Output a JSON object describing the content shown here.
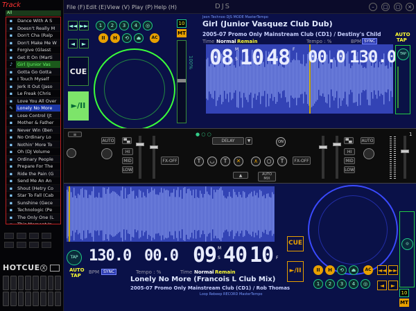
{
  "left_panel": {
    "title": "Track",
    "all_label": "All",
    "playlist": [
      {
        "title": "Dance With A S",
        "state": "normal"
      },
      {
        "title": "Doesn't Really M",
        "state": "normal"
      },
      {
        "title": "Don't Cha (Ralp",
        "state": "normal"
      },
      {
        "title": "Don't Make Me W",
        "state": "normal"
      },
      {
        "title": "Forgive (Glasst",
        "state": "normal"
      },
      {
        "title": "Get It On (Marti",
        "state": "normal"
      },
      {
        "title": "Girl (Junior Vas",
        "state": "playing_a"
      },
      {
        "title": "Gotta Go Gotta",
        "state": "normal"
      },
      {
        "title": "I Touch Myself",
        "state": "normal"
      },
      {
        "title": "Jerk It Out (Jaso",
        "state": "normal"
      },
      {
        "title": "Le Freak (Chris",
        "state": "normal"
      },
      {
        "title": "Love You All Over",
        "state": "normal"
      },
      {
        "title": "Lonely No More",
        "state": "playing_b"
      },
      {
        "title": "Lose Control (Jt",
        "state": "normal"
      },
      {
        "title": "Mother & Father",
        "state": "normal"
      },
      {
        "title": "Never Win (Ben",
        "state": "normal"
      },
      {
        "title": "No Ordinary Lo",
        "state": "normal"
      },
      {
        "title": "Nothin' More To",
        "state": "normal"
      },
      {
        "title": "Oh (DJ Volume",
        "state": "normal"
      },
      {
        "title": "Ordinary People",
        "state": "normal"
      },
      {
        "title": "Prepare For The",
        "state": "normal"
      },
      {
        "title": "Ride the Pain (G",
        "state": "normal"
      },
      {
        "title": "Send Me An An",
        "state": "normal"
      },
      {
        "title": "Shout (Hetry Co",
        "state": "normal"
      },
      {
        "title": "Star To Fall (Cab",
        "state": "normal"
      },
      {
        "title": "Sunshine (Gece",
        "state": "normal"
      },
      {
        "title": "Technologic (Pe",
        "state": "normal"
      },
      {
        "title": "The Only One (L",
        "state": "normal"
      },
      {
        "title": "This Moment In",
        "state": "normal"
      },
      {
        "title": "We Belong Toget",
        "state": "normal"
      },
      {
        "title": "When The Broke",
        "state": "normal"
      }
    ],
    "hotcue_label": "HOTCUE",
    "hotcue_x": "X"
  },
  "menu": {
    "items": [
      "File (F)",
      "Edit (E)",
      "View (V)",
      "Play (P)",
      "Help (H)"
    ],
    "app_title": "DJS"
  },
  "deck_a": {
    "brand": "Jeon  Technoo  DJS MODE  MasterTempo",
    "title": "Girl (Junior Vasquez Club Dub)",
    "subtitle": "2005-07 Promo Only Mainstream Club (CD1) / Destiny's Child",
    "time_label": "Time",
    "normal": "Normal",
    "remain": "Remain",
    "tempo_label": "Tempo : %",
    "bpm_label": "BPM",
    "sync_label": "SYNC",
    "time_m": "08",
    "time_s": "10",
    "time_f": "48",
    "unit_m": "M",
    "unit_s": "S",
    "unit_f": "F",
    "tempo": "00.0",
    "bpm": "130.0",
    "cue": "CUE",
    "play": "►/II",
    "pitch_num": "10",
    "mt": "MT",
    "auto": "AUTO",
    "tap": "TAP",
    "pitch_text": "100%",
    "counter_text": "1 2 3 4"
  },
  "mixer": {
    "effect": "DELAY",
    "on": "ON",
    "fx_off_left": "FX-OFF",
    "fx_off_right": "FX-OFF",
    "auto_mix": "AUTO MIX",
    "auto": "AUTO",
    "hi": "HI",
    "mid": "MID",
    "low": "LOW",
    "gain": "GAIN",
    "vol_master": "1"
  },
  "deck_b": {
    "title": "Lonely No More (Francois L Club Mix)",
    "subtitle": "2005-07 Promo Only Mainstream Club (CD1) / Rob Thomas",
    "brand": "Loop  Rebeep  RECORD  MasterTempo",
    "time_label": "Time",
    "normal": "Normal",
    "remain": "Remain",
    "tempo_label": "Tempo : %",
    "bpm_label": "BPM",
    "sync_label": "SYNC",
    "time_m": "09",
    "time_s": "40",
    "time_f": "10",
    "unit_m": "M",
    "unit_s": "S",
    "unit_f": "F",
    "tempo": "00.0",
    "bpm": "130.0",
    "cue": "CUE",
    "play": "►/II",
    "pitch_num": "10",
    "mt": "MT",
    "auto": "AUTO",
    "tap": "TAP"
  }
}
